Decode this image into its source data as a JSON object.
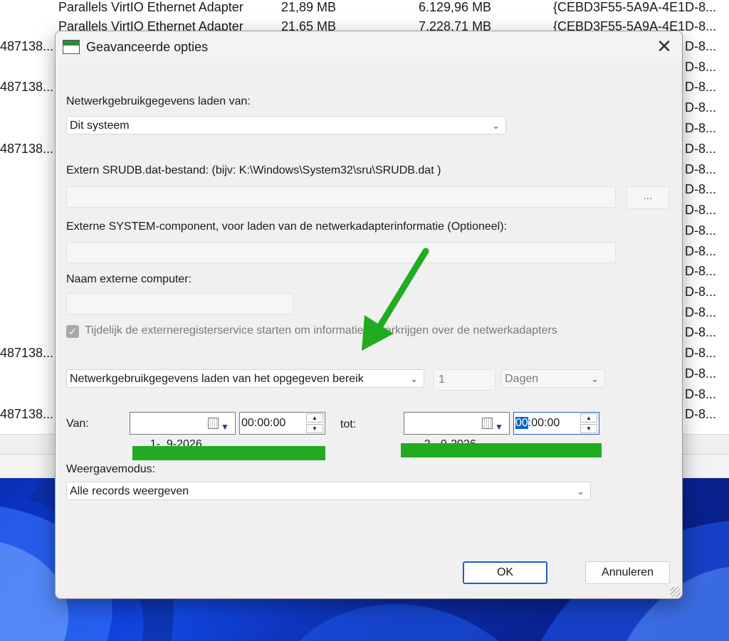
{
  "background": {
    "rows": [
      {
        "name": "Parallels VirtIO Ethernet Adapter",
        "size1": "21,89 MB",
        "size2": "6.129,96 MB",
        "guid": "{CEBD3F55-5A9A-4E1D-8..."
      },
      {
        "name": "Parallels VirtIO Ethernet Adapter",
        "size1": "21,65 MB",
        "size2": "7.228,71 MB",
        "guid": "{CEBD3F55-5A9A-4E1D-8..."
      }
    ],
    "left_fragments": [
      "487138...",
      "487138...",
      "487138...",
      "487138...",
      "487138..."
    ],
    "right_fragments": [
      "D-8...",
      "D-8...",
      "D-8...",
      "D-8...",
      "D-8...",
      "D-8...",
      "D-8...",
      "D-8...",
      "D-8...",
      "D-8...",
      "D-8...",
      "D-8...",
      "D-8...",
      "D-8...",
      "D-8...",
      "D-8...",
      "D-8...",
      "D-8...",
      "D-8...",
      "D-8..."
    ]
  },
  "dialog": {
    "title": "Geavanceerde opties",
    "close_label": "✕",
    "load_from_label": "Netwerkgebruikgegevens laden van:",
    "load_from_value": "Dit systeem",
    "srudb_label": "Extern SRUDB.dat-bestand: (bijv: K:\\Windows\\System32\\sru\\SRUDB.dat )",
    "srudb_value": "",
    "browse_label": "...",
    "system_label": "Externe SYSTEM-component, voor laden van de netwerkadapterinformatie (Optioneel):",
    "system_value": "",
    "computer_label": "Naam externe computer:",
    "computer_value": "",
    "checkbox_label": "Tijdelijk de externeregisterservice starten om informatie te verkrijgen over de netwerkadapters",
    "checkbox_checked": true,
    "range_mode_value": "Netwerkgebruikgegevens laden van het opgegeven bereik",
    "range_number": "1",
    "range_unit": "Dagen",
    "from_label": "Van:",
    "from_date": "1-  9-2026",
    "from_time": "00:00:00",
    "to_label": "tot:",
    "to_date": "2-  9-2026",
    "to_time_selected": "00",
    "to_time_rest": ":00:00",
    "display_mode_label": "Weergavemodus:",
    "display_mode_value": "Alle records weergeven",
    "ok_label": "OK",
    "cancel_label": "Annuleren"
  },
  "colors": {
    "annotation_green": "#21ab21",
    "accent_blue": "#0a64c9"
  }
}
